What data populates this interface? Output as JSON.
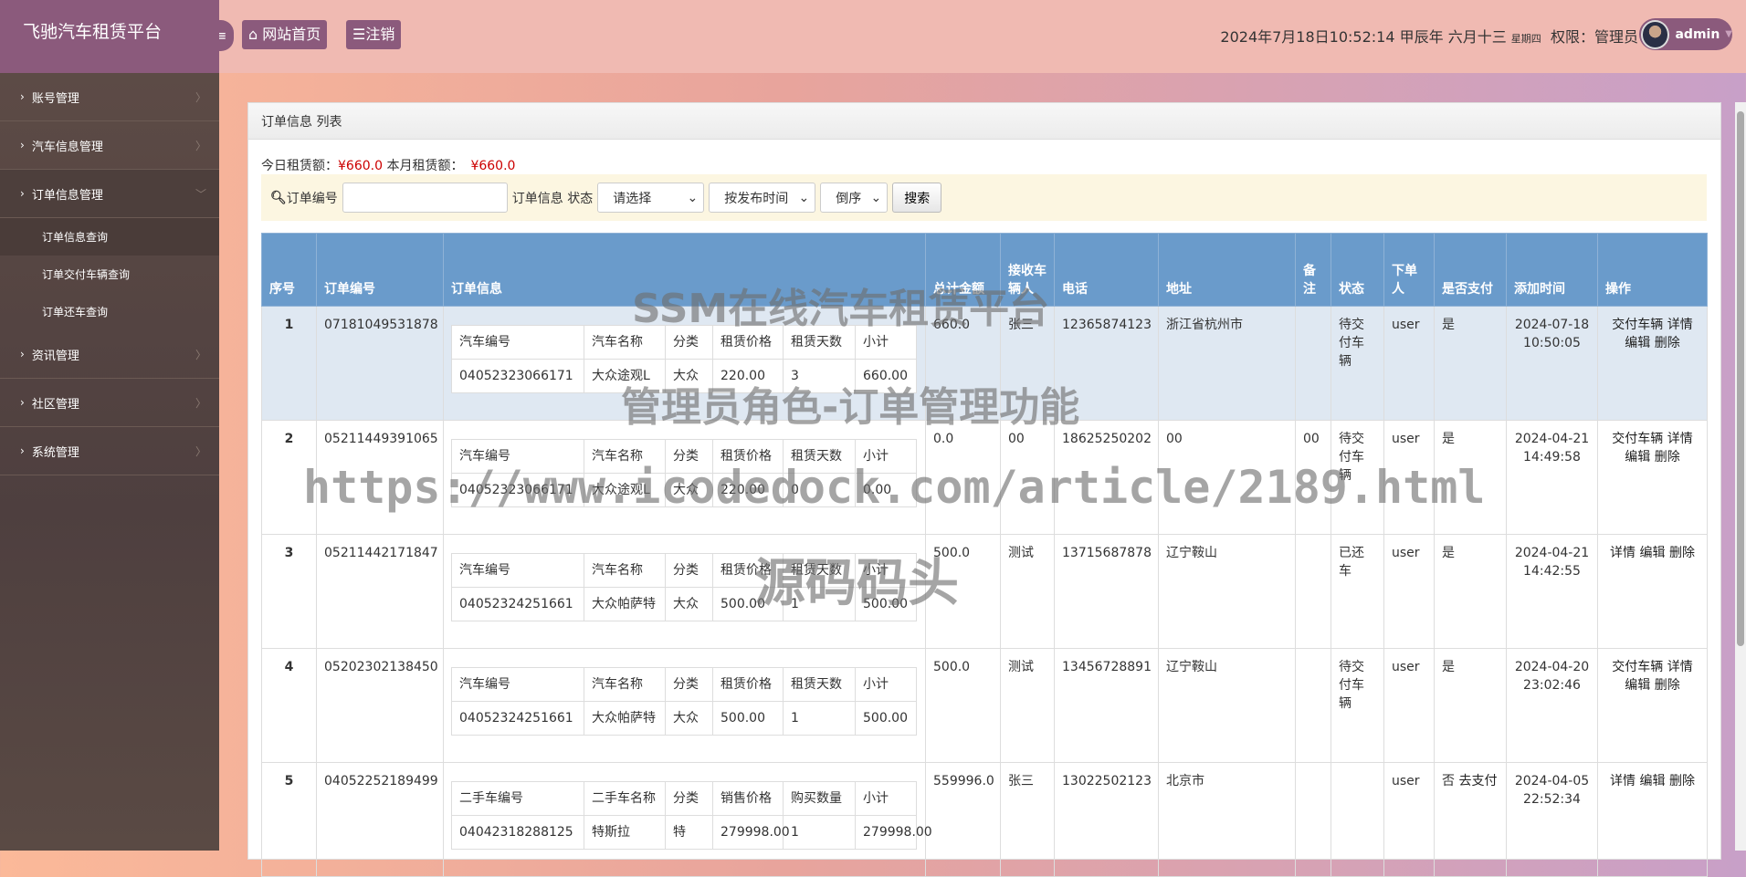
{
  "app": {
    "title": "飞驰汽车租赁平台"
  },
  "sidebar": {
    "items": [
      {
        "label": "账号管理"
      },
      {
        "label": "汽车信息管理"
      },
      {
        "label": "订单信息管理",
        "open": true,
        "children": [
          {
            "label": "订单信息查询",
            "active": true
          },
          {
            "label": "订单交付车辆查询"
          },
          {
            "label": "订单还车查询"
          }
        ]
      },
      {
        "label": "资讯管理"
      },
      {
        "label": "社区管理"
      },
      {
        "label": "系统管理"
      }
    ]
  },
  "header": {
    "home_label": "网站首页",
    "logout_label": "注销",
    "datetime": "2024年7月18日10:52:14 甲辰年 六月十三",
    "weekday": "星期四",
    "role_label": "权限：",
    "role": "管理员",
    "username": "admin"
  },
  "panel": {
    "title": "订单信息 列表"
  },
  "summary": {
    "today_label": "今日租赁额：",
    "today_value": "¥660.0",
    "month_label": "本月租赁额：",
    "month_value": "¥660.0"
  },
  "search": {
    "order_no_label": "订单编号",
    "order_no_value": "",
    "order_info_label": "订单信息",
    "status_label": "状态",
    "status_selected": "请选择",
    "sort_selected": "按发布时间",
    "order_selected": "倒序",
    "search_label": "搜索"
  },
  "table": {
    "headers": [
      "序号",
      "订单编号",
      "订单信息",
      "总计金额",
      "接收车辆人",
      "电话",
      "地址",
      "备注",
      "状态",
      "下单人",
      "是否支付",
      "添加时间",
      "操作"
    ],
    "rows": [
      {
        "seq": "1",
        "order_no": "07181049531878",
        "sub_headers": [
          "汽车编号",
          "汽车名称",
          "分类",
          "租赁价格",
          "租赁天数",
          "小计"
        ],
        "sub_row": [
          "04052323066171",
          "大众途观L",
          "大众",
          "220.00",
          "3",
          "660.00"
        ],
        "total": "660.0",
        "receiver": "张三",
        "phone": "12365874123",
        "address": "浙江省杭州市",
        "remark": "",
        "status": "待交付车辆",
        "user": "user",
        "paid": "是",
        "pay_link": "",
        "time": "2024-07-18 10:50:05",
        "ops": [
          "交付车辆",
          "详情",
          "编辑",
          "删除"
        ],
        "highlight": true
      },
      {
        "seq": "2",
        "order_no": "05211449391065",
        "sub_headers": [
          "汽车编号",
          "汽车名称",
          "分类",
          "租赁价格",
          "租赁天数",
          "小计"
        ],
        "sub_row": [
          "04052323066171",
          "大众途观L",
          "大众",
          "220.00",
          "0",
          "0.00"
        ],
        "total": "0.0",
        "receiver": "00",
        "phone": "18625250202",
        "address": "00",
        "remark": "00",
        "status": "待交付车辆",
        "user": "user",
        "paid": "是",
        "pay_link": "",
        "time": "2024-04-21 14:49:58",
        "ops": [
          "交付车辆",
          "详情",
          "编辑",
          "删除"
        ]
      },
      {
        "seq": "3",
        "order_no": "05211442171847",
        "sub_headers": [
          "汽车编号",
          "汽车名称",
          "分类",
          "租赁价格",
          "租赁天数",
          "小计"
        ],
        "sub_row": [
          "04052324251661",
          "大众帕萨特",
          "大众",
          "500.00",
          "1",
          "500.00"
        ],
        "total": "500.0",
        "receiver": "测试",
        "phone": "13715687878",
        "address": "辽宁鞍山",
        "remark": "",
        "status": "已还车",
        "user": "user",
        "paid": "是",
        "pay_link": "",
        "time": "2024-04-21 14:42:55",
        "ops": [
          "详情",
          "编辑",
          "删除"
        ]
      },
      {
        "seq": "4",
        "order_no": "05202302138450",
        "sub_headers": [
          "汽车编号",
          "汽车名称",
          "分类",
          "租赁价格",
          "租赁天数",
          "小计"
        ],
        "sub_row": [
          "04052324251661",
          "大众帕萨特",
          "大众",
          "500.00",
          "1",
          "500.00"
        ],
        "total": "500.0",
        "receiver": "测试",
        "phone": "13456728891",
        "address": "辽宁鞍山",
        "remark": "",
        "status": "待交付车辆",
        "user": "user",
        "paid": "是",
        "pay_link": "",
        "time": "2024-04-20 23:02:46",
        "ops": [
          "交付车辆",
          "详情",
          "编辑",
          "删除"
        ]
      },
      {
        "seq": "5",
        "order_no": "04052252189499",
        "sub_headers": [
          "二手车编号",
          "二手车名称",
          "分类",
          "销售价格",
          "购买数量",
          "小计"
        ],
        "sub_row": [
          "04042318288125",
          "特斯拉",
          "特",
          "279998.00",
          "1",
          "279998.00"
        ],
        "total": "559996.0",
        "receiver": "张三",
        "phone": "13022502123",
        "address": "北京市",
        "remark": "",
        "status": "",
        "user": "user",
        "paid": "否",
        "pay_link": "去支付",
        "time": "2024-04-05 22:52:34",
        "ops": [
          "详情",
          "编辑",
          "删除"
        ]
      }
    ]
  },
  "watermark": {
    "line1": "SSM在线汽车租赁平台",
    "line2": "管理员角色-订单管理功能",
    "url": "https://www.icodedock.com/article/2189.html",
    "line4": "源码码头"
  },
  "colors": {
    "sidebar_logo": "#8b5a7c",
    "header": "#f0bab2",
    "table_header": "#6a9bcb",
    "price": "#cc0000"
  }
}
